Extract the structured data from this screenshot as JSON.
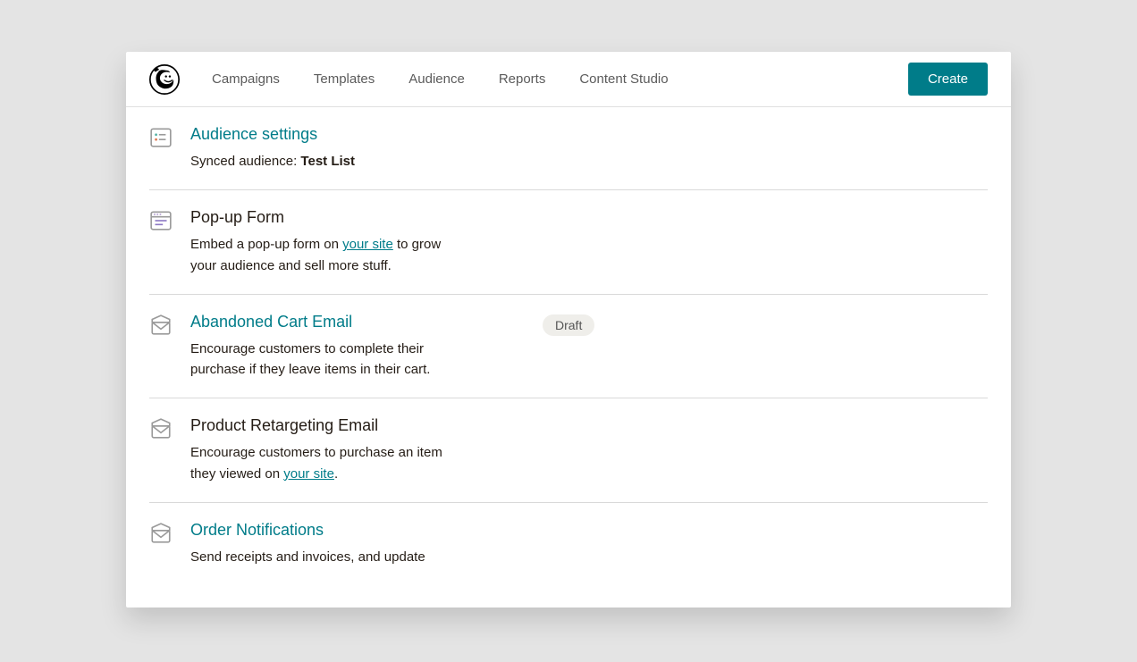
{
  "nav": {
    "items": [
      "Campaigns",
      "Templates",
      "Audience",
      "Reports",
      "Content Studio"
    ],
    "create_label": "Create"
  },
  "rows": [
    {
      "icon": "settings-card-icon",
      "title": "Audience settings",
      "title_style": "teal",
      "desc_prefix": "Synced audience: ",
      "desc_bold": "Test List"
    },
    {
      "icon": "form-icon",
      "title": "Pop-up Form",
      "title_style": "dark",
      "desc_part1": "Embed a pop-up form on ",
      "desc_link_text": "your site",
      "desc_part2": " to grow your audience and sell more stuff."
    },
    {
      "icon": "email-icon",
      "title": "Abandoned Cart Email",
      "title_style": "teal",
      "badge": "Draft",
      "desc_full": "Encourage customers to complete their purchase if they leave items in their cart."
    },
    {
      "icon": "email-icon",
      "title": "Product Retargeting Email",
      "title_style": "dark",
      "desc_part1": "Encourage customers to purchase an item they viewed on ",
      "desc_link_text": "your site",
      "desc_part2": "."
    },
    {
      "icon": "email-icon",
      "title": "Order Notifications",
      "title_style": "teal",
      "desc_full": "Send receipts and invoices, and update"
    }
  ]
}
